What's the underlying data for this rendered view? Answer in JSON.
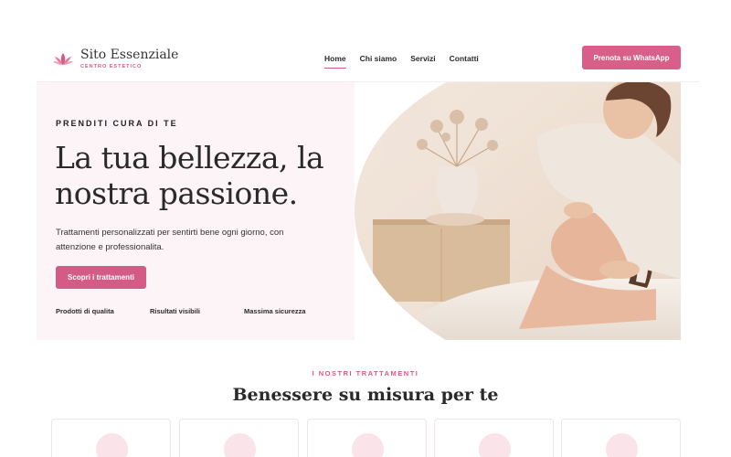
{
  "brand": {
    "title": "Sito Essenziale",
    "subtitle": "CENTRO ESTETICO",
    "logo_icon": "lotus-icon",
    "accent": "#d45b86"
  },
  "nav": {
    "items": [
      {
        "label": "Home",
        "active": true
      },
      {
        "label": "Chi siamo",
        "active": false
      },
      {
        "label": "Servizi",
        "active": false
      },
      {
        "label": "Contatti",
        "active": false
      }
    ],
    "cta_label": "Prenota su WhatsApp"
  },
  "hero": {
    "eyebrow": "PRENDITI CURA DI TE",
    "headline_line1": "La tua bellezza, la",
    "headline_line2": "nostra passione.",
    "description": "Trattamenti personalizzati per sentirti bene ogni giorno, con attenzione e professionalita.",
    "button_label": "Scopri i trattamenti",
    "features": [
      "Prodotti di qualita",
      "Risultati visibili",
      "Massima sicurezza"
    ],
    "image_alt": "facial-treatment-photo",
    "background": "#fdf4f7"
  },
  "treatments": {
    "eyebrow": "I NOSTRI TRATTAMENTI",
    "title": "Benessere su misura per te",
    "cards": [
      {
        "icon": "treatment-icon"
      },
      {
        "icon": "treatment-icon"
      },
      {
        "icon": "treatment-icon"
      },
      {
        "icon": "treatment-icon"
      },
      {
        "icon": "treatment-icon"
      }
    ]
  }
}
